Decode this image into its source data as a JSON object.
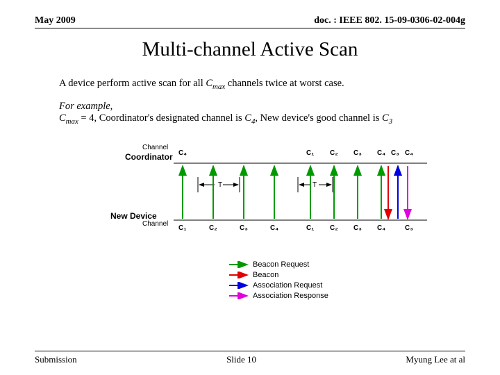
{
  "header": {
    "left": "May 2009",
    "right": "doc. : IEEE 802. 15-09-0306-02-004g"
  },
  "title": "Multi-channel Active Scan",
  "line1_a": "A device perform active scan for all ",
  "line1_b": " channels twice at worst case.",
  "cmax": "C",
  "cmax_sub": "max",
  "ex1": "For example,",
  "ex2_a": " = 4, Coordinator's designated channel is ",
  "ex2_b": ", New device's good channel is ",
  "c4": "C",
  "c4_sub": "4",
  "c3": "C",
  "c3_sub": "3",
  "labels": {
    "channel": "Channel",
    "coord": "Coordinator",
    "newdev": "New Device",
    "T": "T"
  },
  "coord_ch": [
    "C₄",
    "C₁",
    "C₂",
    "C₃",
    "C₄",
    "C₃",
    "C₄"
  ],
  "nd_ch": [
    "C₁",
    "C₂",
    "C₃",
    "C₄",
    "C₁",
    "C₂",
    "C₃",
    "C₄",
    "C₃"
  ],
  "legend": [
    "Beacon Request",
    "Beacon",
    "Association Request",
    "Association Response"
  ],
  "footer": {
    "left": "Submission",
    "center": "Slide 10",
    "right": "Myung Lee at al"
  }
}
